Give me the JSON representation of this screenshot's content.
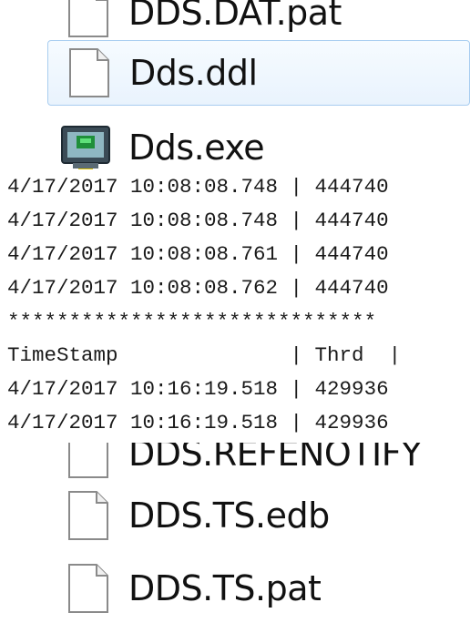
{
  "files": [
    {
      "name": "DDS.DAT.pat",
      "icon": "file-icon"
    },
    {
      "name": "Dds.ddl",
      "icon": "file-icon",
      "selected": true
    },
    {
      "name": "Dds.exe",
      "icon": "exe-icon"
    },
    {
      "name": "DDS.REFENOTIFY",
      "icon": "file-icon"
    },
    {
      "name": "DDS.TS.edb",
      "icon": "file-icon"
    },
    {
      "name": "DDS.TS.pat",
      "icon": "file-icon"
    }
  ],
  "log": {
    "lines": [
      "4/17/2017 10:08:08.748 | 444740",
      "4/17/2017 10:08:08.748 | 444740",
      "4/17/2017 10:08:08.761 | 444740",
      "4/17/2017 10:08:08.762 | 444740",
      "******************************",
      "TimeStamp              | Thrd  |",
      "4/17/2017 10:16:19.518 | 429936",
      "4/17/2017 10:16:19.518 | 429936"
    ]
  },
  "colors": {
    "selection_border": "#a8cdf0",
    "selection_fill": "#e9f3fd",
    "exe_screen": "#1f8f3a"
  }
}
